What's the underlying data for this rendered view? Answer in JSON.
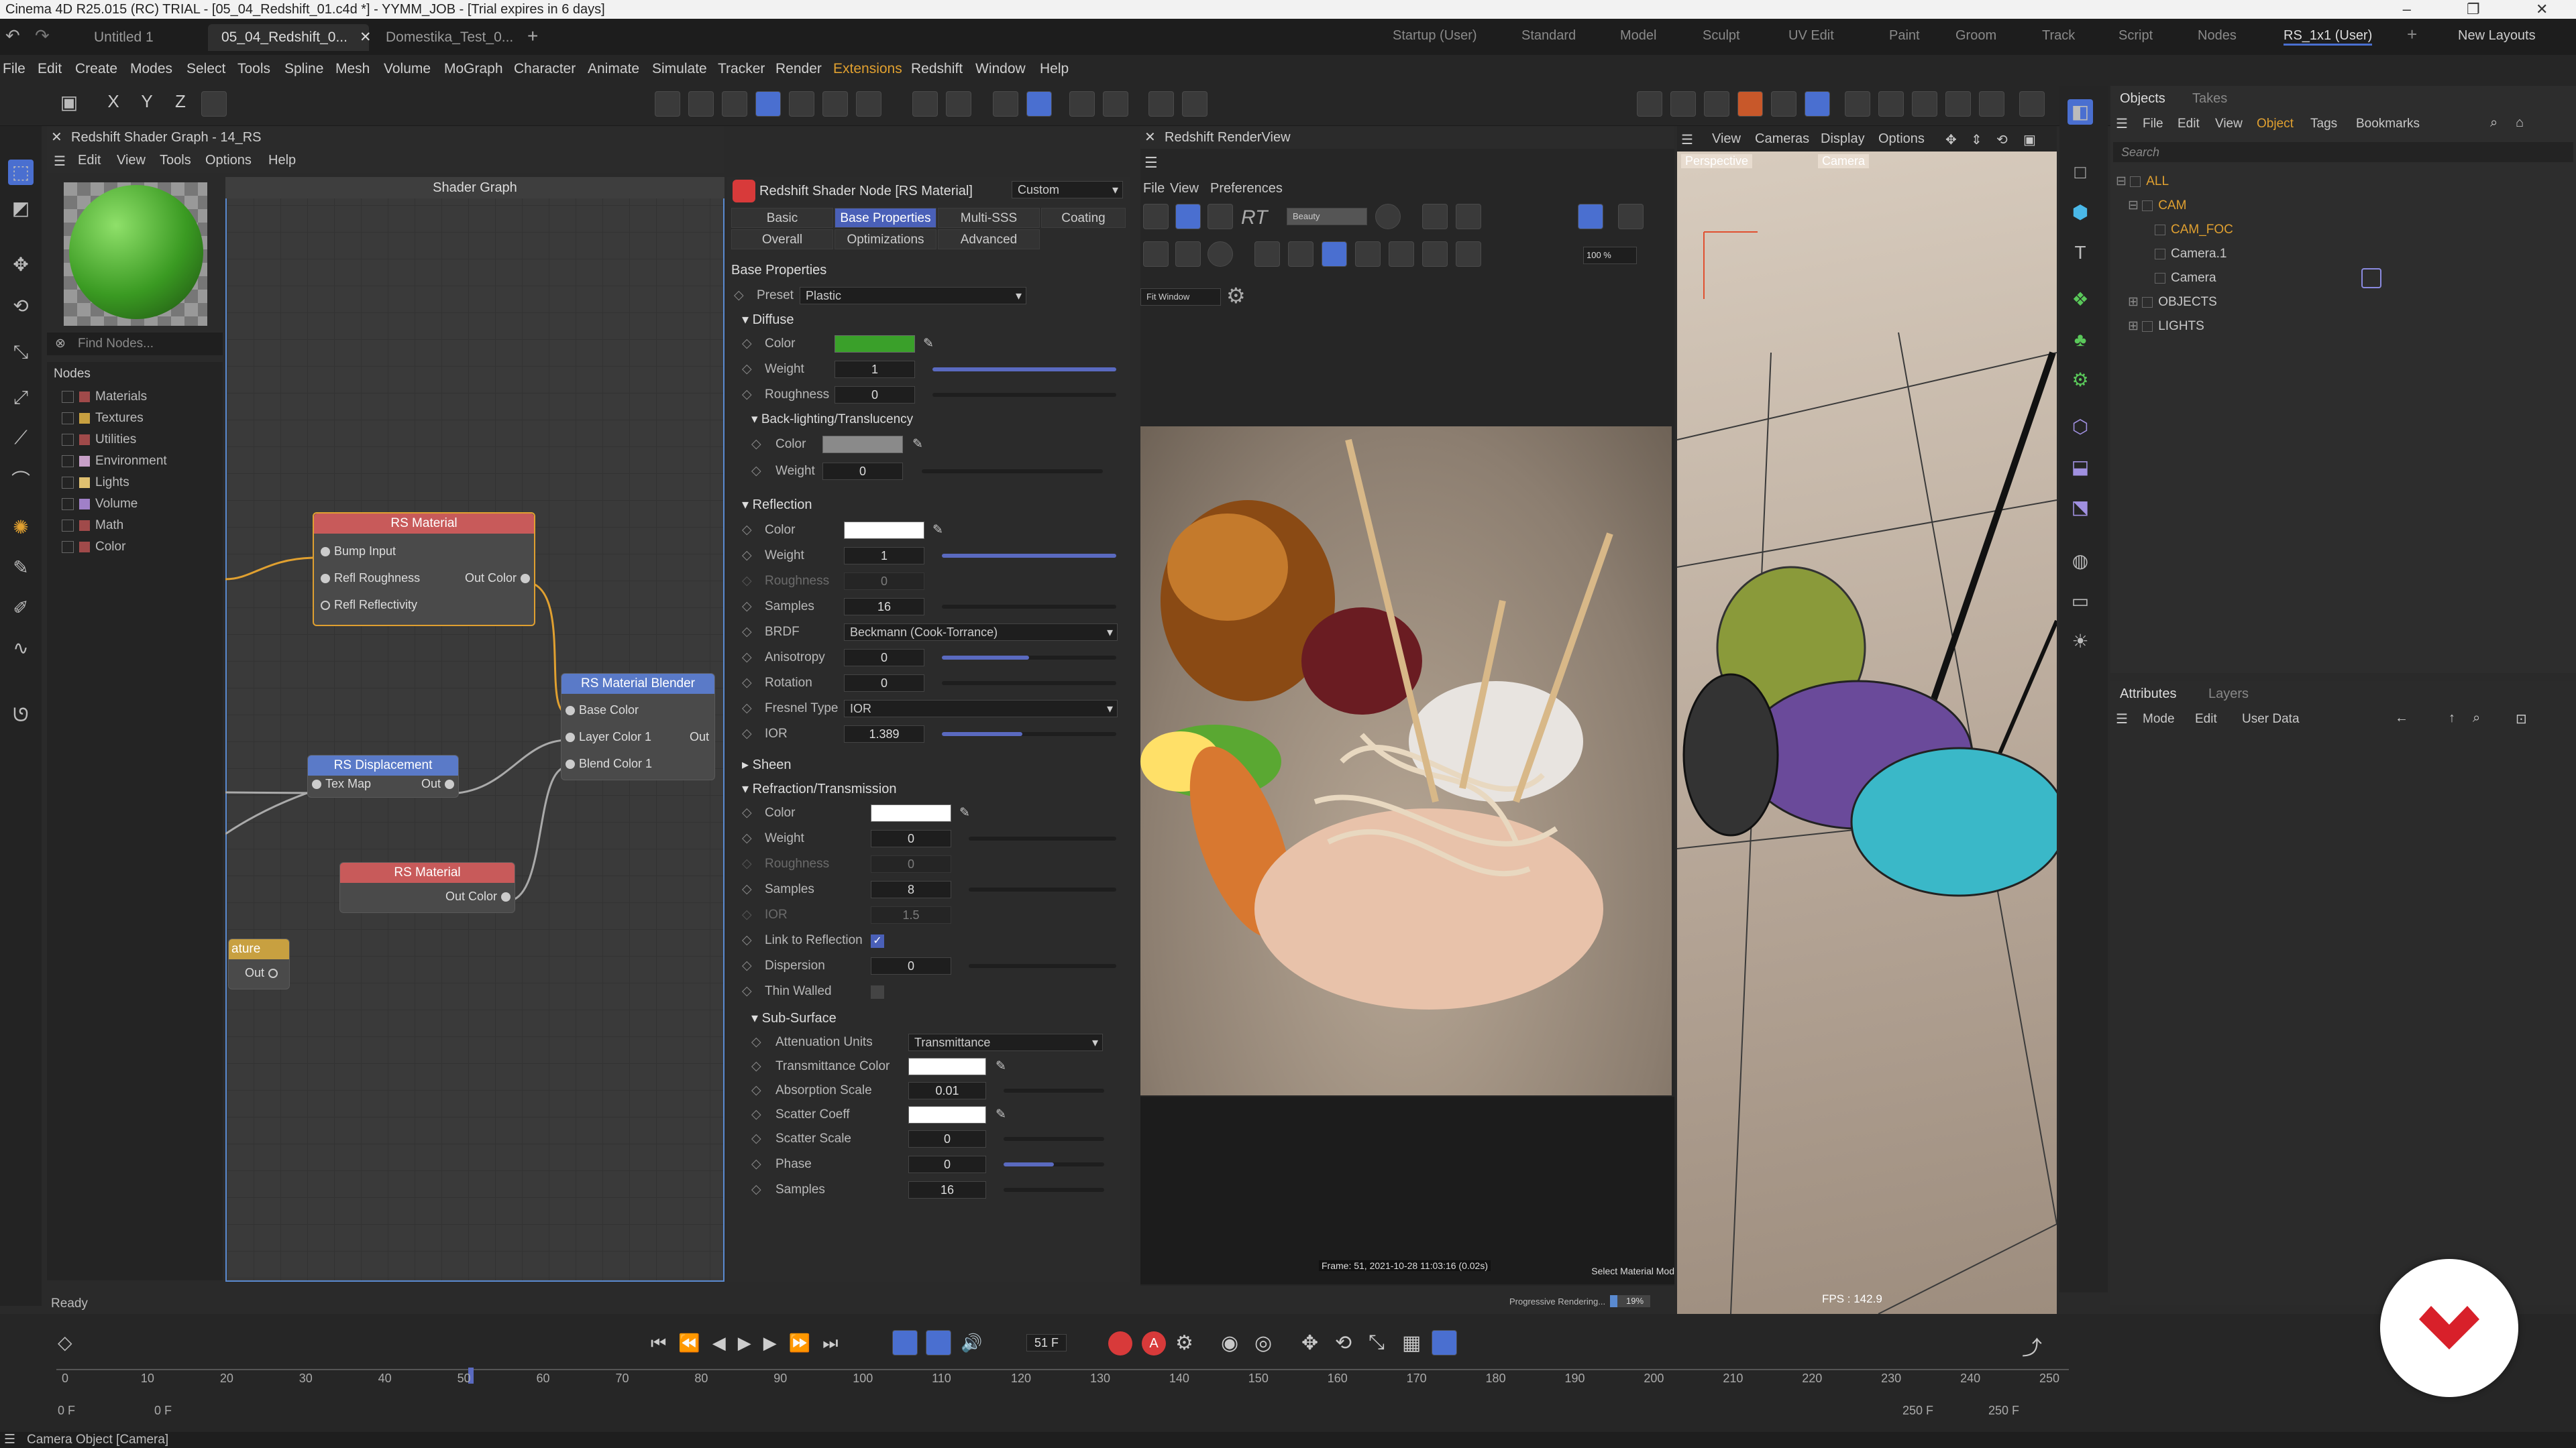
{
  "window": {
    "title": "Cinema 4D R25.015 (RC) TRIAL - [05_04_Redshift_01.c4d *] - YYMM_JOB - [Trial expires in 6 days]"
  },
  "doc_tabs": [
    "Untitled 1",
    "05_04_Redshift_0...",
    "Domestika_Test_0..."
  ],
  "layouts": [
    "Startup (User)",
    "Standard",
    "Model",
    "Sculpt",
    "UV Edit",
    "Paint",
    "Groom",
    "Track",
    "Script",
    "Nodes",
    "RS_1x1 (User)",
    "New Layouts"
  ],
  "menu": [
    "File",
    "Edit",
    "Create",
    "Modes",
    "Select",
    "Tools",
    "Spline",
    "Mesh",
    "Volume",
    "MoGraph",
    "Character",
    "Animate",
    "Simulate",
    "Tracker",
    "Render",
    "Extensions",
    "Redshift",
    "Window",
    "Help"
  ],
  "shader_graph": {
    "title": "Redshift Shader Graph - 14_RS",
    "menu": [
      "Edit",
      "View",
      "Tools",
      "Options",
      "Help"
    ],
    "find_placeholder": "Find Nodes...",
    "nodes_label": "Nodes",
    "categories": [
      "Materials",
      "Textures",
      "Utilities",
      "Environment",
      "Lights",
      "Volume",
      "Math",
      "Color"
    ],
    "graph_title": "Shader Graph",
    "node1": {
      "title": "RS Material",
      "ports": [
        "Bump Input",
        "Refl Roughness",
        "Refl Reflectivity"
      ],
      "out": "Out Color"
    },
    "node2": {
      "title": "RS Material Blender",
      "ports": [
        "Base Color",
        "Layer Color 1",
        "Blend Color 1"
      ],
      "out": "Out"
    },
    "node3": {
      "title": "RS Displacement",
      "in": "Tex Map",
      "out": "Out"
    },
    "node4": {
      "title": "RS Material",
      "out": "Out Color"
    },
    "node5": {
      "title": "ature",
      "out": "Out"
    }
  },
  "attr": {
    "header": "Redshift Shader Node [RS Material]",
    "preset_mode": "Custom",
    "tabs_row1": [
      "Basic",
      "Base Properties",
      "Multi-SSS",
      "Coating"
    ],
    "tabs_row2": [
      "Overall",
      "Optimizations",
      "Advanced"
    ],
    "section_title": "Base Properties",
    "preset_label": "Preset",
    "preset_value": "Plastic",
    "diffuse": "Diffuse",
    "color": "Color",
    "weight": "Weight",
    "roughness": "Roughness",
    "diffuse_weight": "1",
    "diffuse_rough": "0",
    "backlight": "Back-lighting/Translucency",
    "back_weight": "0",
    "reflection": "Reflection",
    "refl_weight": "1",
    "refl_rough": "0",
    "samples": "Samples",
    "refl_samples": "16",
    "brdf": "BRDF",
    "brdf_value": "Beckmann (Cook-Torrance)",
    "anisotropy": "Anisotropy",
    "aniso_value": "0",
    "rotation": "Rotation",
    "rot_value": "0",
    "fresnel": "Fresnel Type",
    "fresnel_value": "IOR",
    "ior": "IOR",
    "ior_value": "1.389",
    "sheen": "Sheen",
    "refraction": "Refraction/Transmission",
    "refr_weight": "0",
    "refr_rough": "0",
    "refr_samples": "8",
    "refr_ior": "1.5",
    "link": "Link to Reflection",
    "dispersion": "Dispersion",
    "disp_value": "0",
    "thin": "Thin Walled",
    "subsurface": "Sub-Surface",
    "att_units": "Attenuation Units",
    "att_value": "Transmittance",
    "trans_color": "Transmittance Color",
    "abs_scale": "Absorption Scale",
    "abs_value": "0.01",
    "scatter_coeff": "Scatter Coeff",
    "scatter_scale": "Scatter Scale",
    "scatter_value": "0",
    "phase": "Phase",
    "phase_value": "0",
    "ss_samples": "16",
    "colors": {
      "diffuse": "#3aa02a",
      "back": "#8a8a8a",
      "refl": "#ffffff",
      "refr": "#ffffff"
    }
  },
  "renderview": {
    "title": "Redshift RenderView",
    "menu": [
      "File",
      "View",
      "Preferences"
    ],
    "mode": "Beauty",
    "zoom": "100 %",
    "window": "Fit Window",
    "frame_info": "Frame: 51, 2021-10-28 11:03:16 (0.02s)",
    "select_material": "Select Material Mod",
    "progressive": "Progressive Rendering...",
    "progress_pct": "19%"
  },
  "viewport": {
    "menu": [
      "View",
      "Cameras",
      "Display",
      "Options"
    ],
    "label": "Perspective",
    "camera": "Camera",
    "fps": "FPS : 142.9"
  },
  "objects": {
    "tabs": [
      "Objects",
      "Takes"
    ],
    "menu": [
      "File",
      "Edit",
      "View",
      "Object",
      "Tags",
      "Bookmarks"
    ],
    "search": "Search",
    "items": [
      {
        "name": "ALL",
        "color": "#e0a030"
      },
      {
        "name": "CAM",
        "color": "#e0a030"
      },
      {
        "name": "CAM_FOC",
        "color": "#e0a030"
      },
      {
        "name": "Camera.1",
        "color": "#c8c8c8"
      },
      {
        "name": "Camera",
        "color": "#c8c8c8"
      },
      {
        "name": "OBJECTS",
        "color": "#c8c8c8"
      },
      {
        "name": "LIGHTS",
        "color": "#c8c8c8"
      }
    ]
  },
  "attributes": {
    "tabs": [
      "Attributes",
      "Layers"
    ],
    "menu": [
      "Mode",
      "Edit",
      "User Data"
    ]
  },
  "timeline": {
    "frame": "51 F",
    "start": "0 F",
    "start2": "0 F",
    "end": "250 F",
    "end2": "250 F",
    "ticks": [
      "0",
      "10",
      "20",
      "30",
      "40",
      "50",
      "60",
      "70",
      "80",
      "90",
      "100",
      "110",
      "120",
      "130",
      "140",
      "150",
      "160",
      "170",
      "180",
      "190",
      "200",
      "210",
      "220",
      "230",
      "240",
      "250"
    ]
  },
  "status": {
    "ready": "Ready",
    "bottom": "Camera Object [Camera]"
  }
}
